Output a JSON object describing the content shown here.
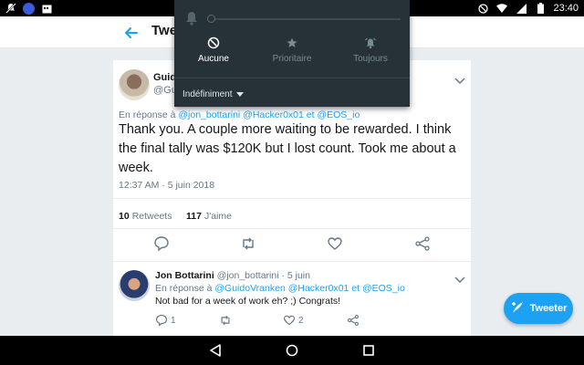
{
  "status_bar": {
    "time": "23:40",
    "left_icons": [
      "notifications-off-icon",
      "app-circle-icon",
      "calendar-icon"
    ],
    "right_icons": [
      "do-not-disturb-icon",
      "wifi-icon",
      "signal-icon",
      "battery-icon"
    ]
  },
  "app_bar": {
    "title": "Twe"
  },
  "tweet": {
    "author_name": "Guid",
    "author_handle": "@Gu",
    "reply_prefix": "En réponse à",
    "reply_to": "@jon_bottarini @Hacker0x01 et @EOS_io",
    "text": "Thank you. A couple more waiting to be rewarded. I think the final tally was $120K but I lost count. Took me about a week.",
    "timestamp": "12:37 AM · 5 juin 2018",
    "retweets_count": "10",
    "retweets_label": "Retweets",
    "likes_count": "117",
    "likes_label": "J'aime"
  },
  "reply": {
    "author_name": "Jon Bottarini",
    "author_handle": "@jon_bottarini",
    "date": "· 5 juin",
    "reply_prefix": "En réponse à",
    "reply_to": "@GuidoVranken @Hacker0x01 et @EOS_io",
    "text": "Not bad for a week of work eh? ;) Congrats!",
    "reply_count": "1",
    "like_count": "2"
  },
  "fab": {
    "label": "Tweeter"
  },
  "dnd_panel": {
    "modes": [
      {
        "label": "Aucune",
        "icon": "block-icon",
        "active": true
      },
      {
        "label": "Prioritaire",
        "icon": "star-icon",
        "active": false
      },
      {
        "label": "Toujours",
        "icon": "alarm-icon",
        "active": false
      }
    ],
    "duration": "Indéfiniment"
  },
  "colors": {
    "accent": "#1da1f2",
    "panel": "#263238",
    "background": "#e9edf0"
  }
}
